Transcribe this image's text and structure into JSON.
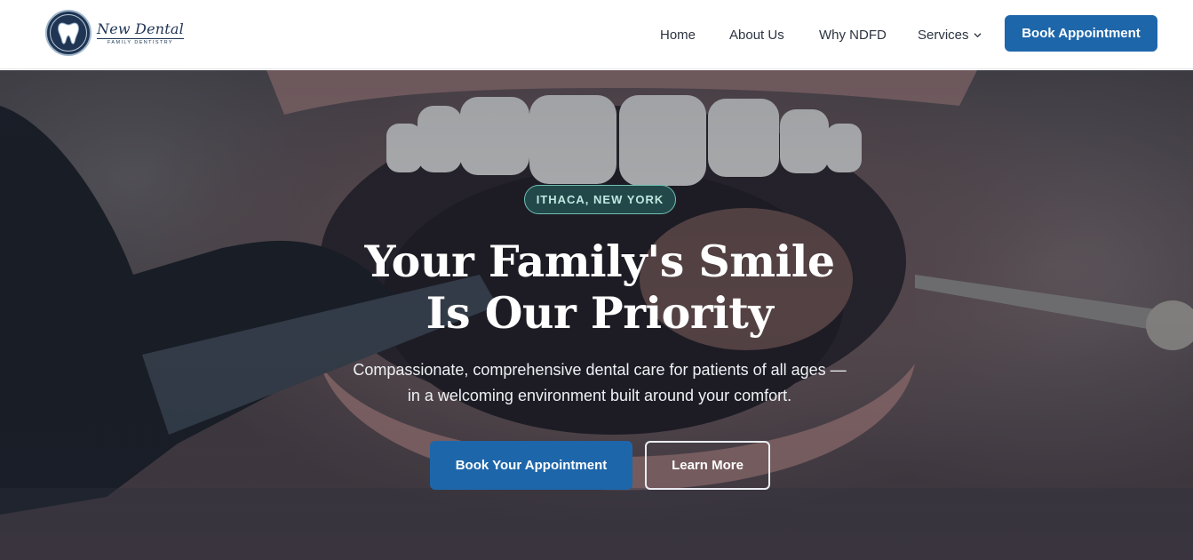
{
  "header": {
    "logo": {
      "name": "New Dental",
      "subtitle": "FAMILY DENTISTRY",
      "icon": "tooth-icon"
    },
    "nav": [
      {
        "label": "Home"
      },
      {
        "label": "About Us"
      },
      {
        "label": "Why NDFD"
      },
      {
        "label": "Services",
        "icon": "chevron-down-icon"
      }
    ],
    "cta_label": "Book Appointment"
  },
  "hero": {
    "badge": "ITHACA, NEW YORK",
    "headline_line1": "Your Family's Smile",
    "headline_line2": "Is Our Priority",
    "subtext_line1": "Compassionate, comprehensive dental care for patients of all ages —",
    "subtext_line2": "in a welcoming environment built around your comfort.",
    "primary_button": "Book Your Appointment",
    "secondary_button": "Learn More"
  },
  "colors": {
    "brand_navy": "#1f3553",
    "primary_blue": "#1e66aa",
    "badge_teal": "#6fc0b3"
  }
}
